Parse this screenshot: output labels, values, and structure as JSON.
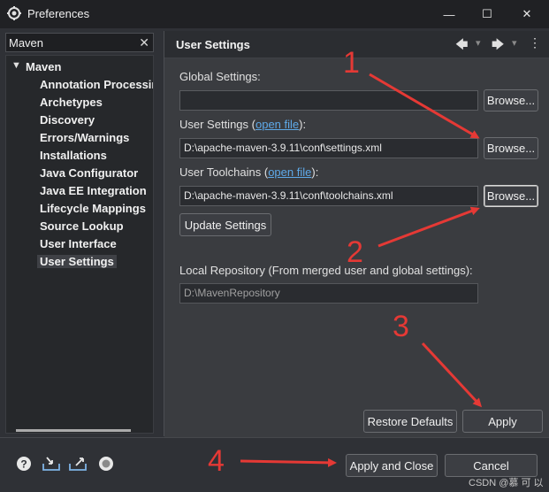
{
  "window": {
    "title": "Preferences",
    "minimize_glyph": "—",
    "maximize_glyph": "☐",
    "close_glyph": "✕"
  },
  "search": {
    "value": "Maven",
    "clear_glyph": "✕"
  },
  "tree": {
    "root": {
      "label": "Maven",
      "expander": "▼"
    },
    "items": [
      {
        "label": "Annotation Processin"
      },
      {
        "label": "Archetypes"
      },
      {
        "label": "Discovery"
      },
      {
        "label": "Errors/Warnings"
      },
      {
        "label": "Installations"
      },
      {
        "label": "Java Configurator"
      },
      {
        "label": "Java EE Integration"
      },
      {
        "label": "Lifecycle Mappings"
      },
      {
        "label": "Source Lookup"
      },
      {
        "label": "User Interface"
      },
      {
        "label": "User Settings",
        "selected": true
      }
    ]
  },
  "page": {
    "title": "User Settings",
    "back_glyph": "🡄",
    "forward_glyph": "🡆",
    "dropdown_glyph": "▾",
    "menu_glyph": "⋮"
  },
  "global_settings": {
    "label": "Global Settings:",
    "value": "",
    "browse": "Browse..."
  },
  "user_settings": {
    "label": "User Settings (",
    "link": "open file",
    "label_end": "):",
    "value": "D:\\apache-maven-3.9.11\\conf\\settings.xml",
    "browse": "Browse..."
  },
  "user_toolchains": {
    "label": "User Toolchains (",
    "link": "open file",
    "label_end": "):",
    "value": "D:\\apache-maven-3.9.11\\conf\\toolchains.xml",
    "browse": "Browse..."
  },
  "update_settings": "Update Settings",
  "local_repo": {
    "label": "Local Repository (From merged user and global settings):",
    "value": "D:\\MavenRepository"
  },
  "buttons": {
    "restore_defaults": "Restore Defaults",
    "apply": "Apply",
    "apply_and_close": "Apply and Close",
    "cancel": "Cancel"
  },
  "bottom_icons": [
    "help-icon",
    "import-icon",
    "export-icon",
    "record-icon"
  ],
  "annotations": [
    "1",
    "2",
    "3",
    "4"
  ],
  "watermark": "CSDN @慕 可 以",
  "colors": {
    "annotation": "#e53935",
    "link": "#5ea9e8"
  }
}
